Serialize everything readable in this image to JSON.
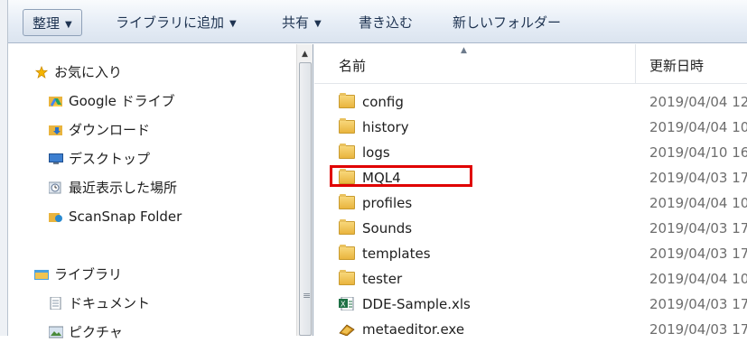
{
  "toolbar": {
    "organize": "整理",
    "add_to_library": "ライブラリに追加",
    "share": "共有",
    "burn": "書き込む",
    "new_folder": "新しいフォルダー"
  },
  "nav": {
    "items": [
      {
        "label": "お気に入り",
        "icon": "star-icon"
      },
      {
        "label": "Google ドライブ",
        "icon": "google-drive-icon"
      },
      {
        "label": "ダウンロード",
        "icon": "download-folder-icon"
      },
      {
        "label": "デスクトップ",
        "icon": "desktop-icon"
      },
      {
        "label": "最近表示した場所",
        "icon": "recent-places-icon"
      },
      {
        "label": "ScanSnap Folder",
        "icon": "scansnap-folder-icon"
      },
      {
        "label": "ライブラリ",
        "icon": "library-icon"
      },
      {
        "label": "ドキュメント",
        "icon": "documents-icon"
      },
      {
        "label": "ピクチャ",
        "icon": "pictures-icon"
      }
    ]
  },
  "list": {
    "columns": {
      "name": "名前",
      "date": "更新日時"
    },
    "rows": [
      {
        "name": "config",
        "date": "2019/04/04 12",
        "icon": "folder-icon"
      },
      {
        "name": "history",
        "date": "2019/04/04 10",
        "icon": "folder-icon"
      },
      {
        "name": "logs",
        "date": "2019/04/10 16",
        "icon": "folder-icon"
      },
      {
        "name": "MQL4",
        "date": "2019/04/03 17",
        "icon": "folder-icon"
      },
      {
        "name": "profiles",
        "date": "2019/04/04 10",
        "icon": "folder-icon"
      },
      {
        "name": "Sounds",
        "date": "2019/04/03 17",
        "icon": "folder-icon"
      },
      {
        "name": "templates",
        "date": "2019/04/03 17",
        "icon": "folder-icon"
      },
      {
        "name": "tester",
        "date": "2019/04/04 10",
        "icon": "folder-icon"
      },
      {
        "name": "DDE-Sample.xls",
        "date": "2019/04/03 17",
        "icon": "excel-file-icon"
      },
      {
        "name": "metaeditor.exe",
        "date": "2019/04/03 17",
        "icon": "exe-file-icon"
      }
    ]
  },
  "colors": {
    "highlight": "#e00000",
    "toolbar": "#e6edf6",
    "folder": "#f1c452"
  }
}
